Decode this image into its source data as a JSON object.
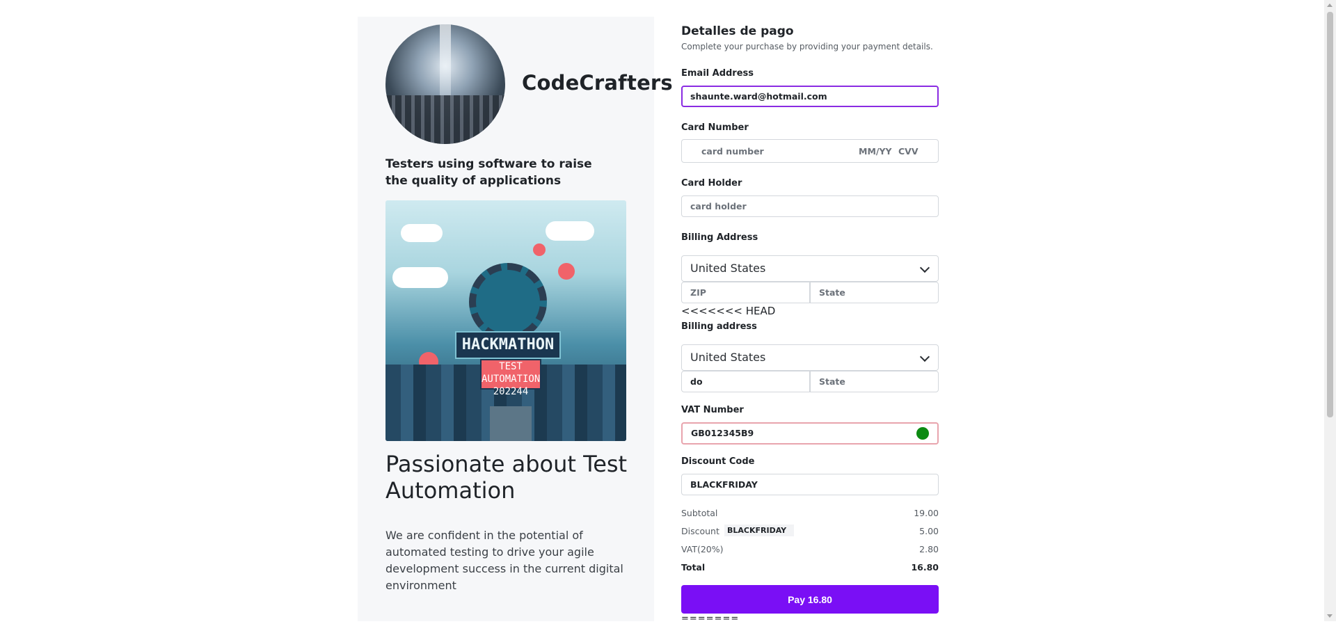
{
  "company": {
    "name": "CodeCrafters",
    "tagline": "Testers using software to raise the quality of applications",
    "headline": "Passionate about Test Automation",
    "blurb": "We are confident in the potential of automated testing to drive your agile development success in the current digital environment",
    "poster": {
      "banner": "HACKMATHON",
      "sign": "TEST AUTOMATION 202244"
    }
  },
  "payment": {
    "title": "Detalles de pago",
    "subtitle": "Complete your purchase by providing your payment details.",
    "email": {
      "label": "Email Address",
      "value": "shaunte.ward@hotmail.com"
    },
    "card": {
      "label": "Card Number",
      "number_placeholder": "card number",
      "expiry_placeholder": "MM/YY",
      "cvv_placeholder": "CVV"
    },
    "holder": {
      "label": "Card Holder",
      "placeholder": "card holder"
    },
    "billing": {
      "label": "Billing Address",
      "country": "United States",
      "zip_placeholder": "ZIP",
      "state_placeholder": "State"
    },
    "conflict_marker": "<<<<<<< HEAD",
    "billing2": {
      "label": "Billing address",
      "country": "United States",
      "zip_value": "do",
      "state_placeholder": "State"
    },
    "vat": {
      "label": "VAT Number",
      "value": "GB012345B9",
      "status_color": "#0c8a12"
    },
    "discount": {
      "label": "Discount Code",
      "value": "BLACKFRIDAY"
    },
    "summary": {
      "subtotal_label": "Subtotal",
      "subtotal": "19.00",
      "discount_label": "Discount",
      "discount_code": "BLACKFRIDAY",
      "discount": "5.00",
      "vat_label": "VAT(20%)",
      "vat": "2.80",
      "total_label": "Total",
      "total": "16.80"
    },
    "pay_button": "Pay  16.80",
    "trailing": "======="
  },
  "colors": {
    "accent": "#7a0ff5",
    "email_focus": "#8a2be2",
    "vat_border": "#e8a4ad"
  }
}
